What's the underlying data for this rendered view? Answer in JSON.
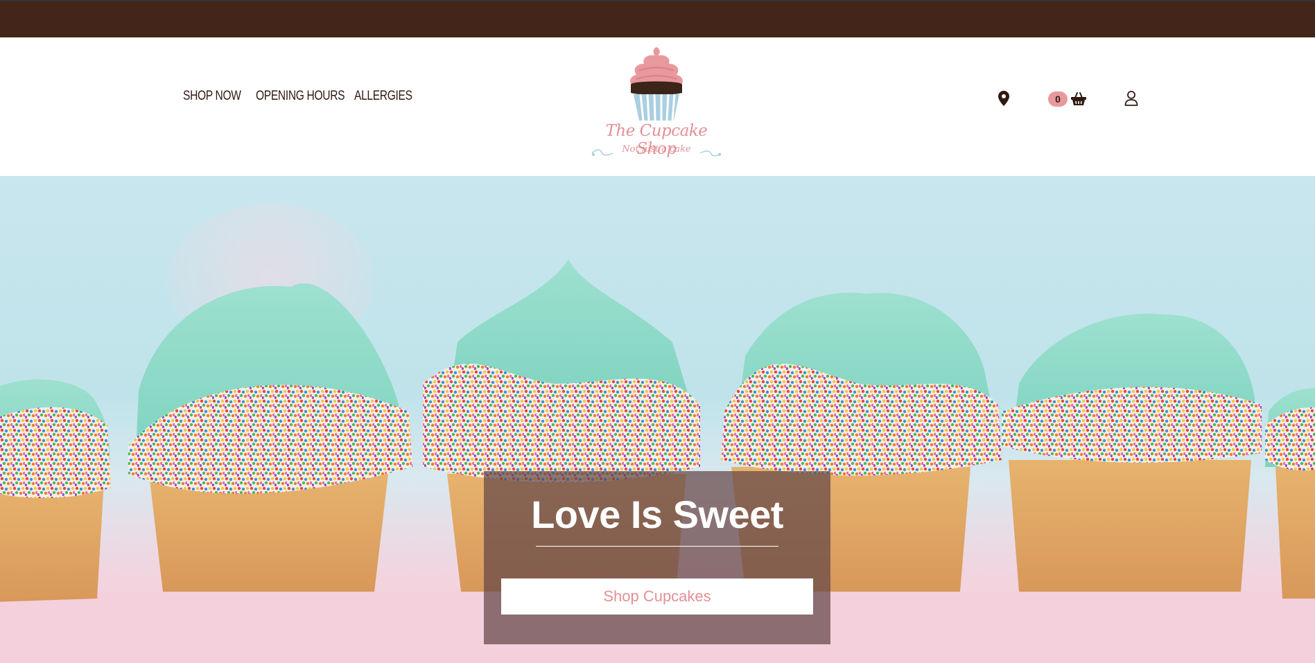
{
  "nav": {
    "shop_now": "Shop Now",
    "opening_hours": "Opening Hours",
    "allergies": "Allergies"
  },
  "logo": {
    "title": "The Cupcake Shop",
    "tagline": "Not just a cake"
  },
  "icons": {
    "location": "map-pin-icon",
    "cart": "basket-icon",
    "account": "user-icon"
  },
  "cart": {
    "count": "0"
  },
  "hero": {
    "title": "Love Is Sweet",
    "cta_label": "Shop Cupcakes"
  },
  "colors": {
    "top_bar": "#432519",
    "nav_text": "#2f1a12",
    "brand_pink": "#e48f96",
    "brand_blue": "#a9cfe0",
    "overlay": "#644648"
  }
}
